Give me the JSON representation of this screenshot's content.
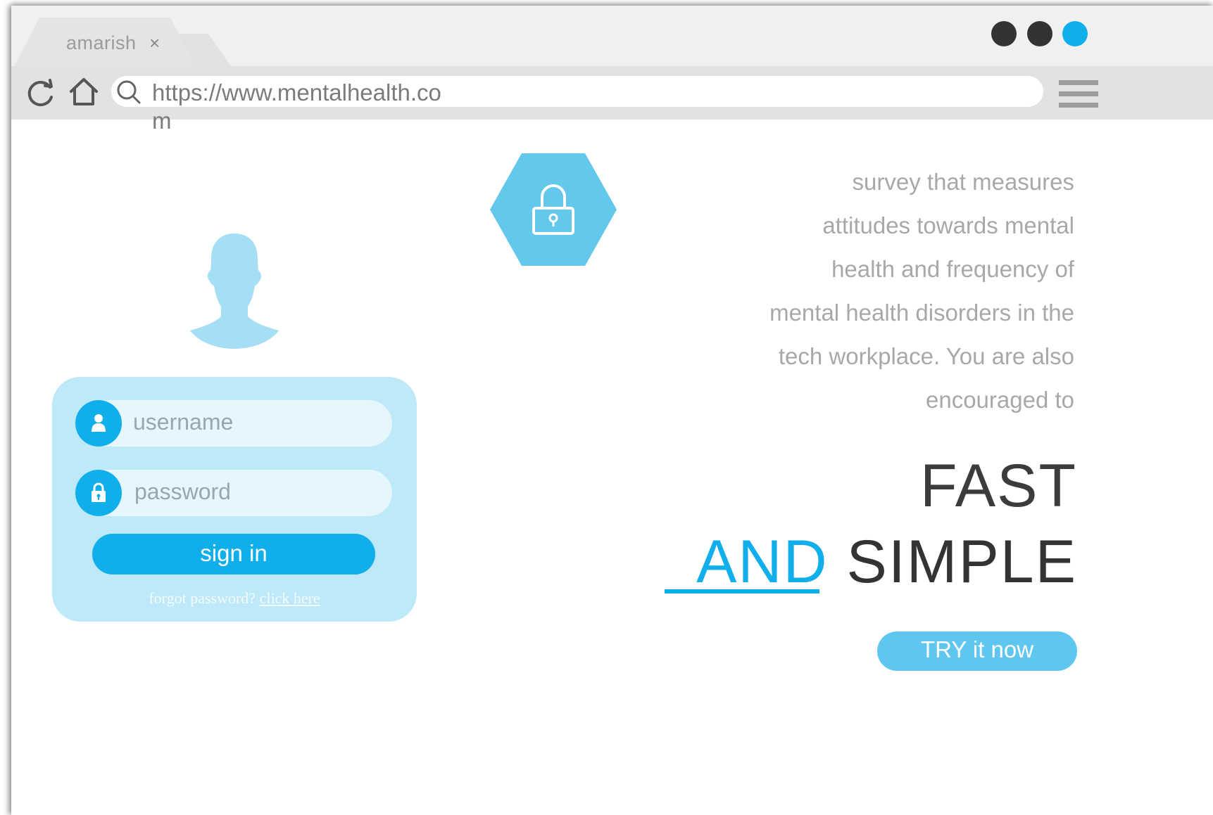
{
  "browser": {
    "tab_title": "amarish",
    "tab_close": "×",
    "url": "https://www.mentalhealth.com",
    "window_dots": [
      {
        "name": "dot-1",
        "color": "#333333"
      },
      {
        "name": "dot-2",
        "color": "#333333"
      },
      {
        "name": "dot-3",
        "color": "#10aeea"
      }
    ],
    "icons": [
      "refresh-icon",
      "home-icon",
      "search-icon",
      "menu-icon"
    ]
  },
  "login": {
    "username_placeholder": "username",
    "password_placeholder": "password",
    "signin_label": "sign in",
    "forgot_text": "forgot password?",
    "forgot_link": "click here"
  },
  "hero": {
    "description": "survey that measures attitudes towards mental health and frequency of mental health disorders in the tech workplace. You are also encouraged to",
    "headline_line1": "FAST",
    "headline_and": "AND",
    "headline_simple": "SIMPLE",
    "cta_label": "TRY it now"
  },
  "colors": {
    "accent": "#10aeea",
    "light_accent": "#64c8ec",
    "card_bg": "#bde9f9"
  }
}
